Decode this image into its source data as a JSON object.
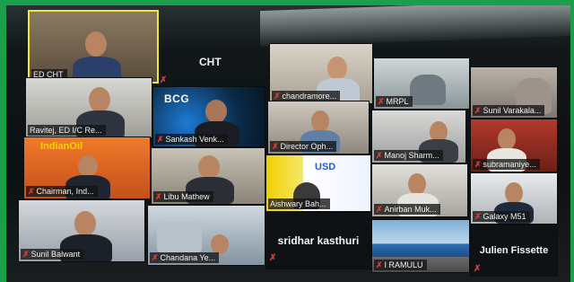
{
  "call": {
    "host_name": "CHT",
    "tiles": [
      {
        "id": "ed-cht",
        "label": "ED CHT",
        "muted": false,
        "active": true
      },
      {
        "id": "ravitej",
        "label": "Ravitej, ED I/C Re...",
        "muted": true
      },
      {
        "id": "bcg",
        "label": "Sankash Venk...",
        "muted": true,
        "logo": "BCG"
      },
      {
        "id": "chandramore",
        "label": "chandramore...",
        "muted": true
      },
      {
        "id": "mrpl",
        "label": "MRPL",
        "muted": true
      },
      {
        "id": "sunil-v",
        "label": "Sunil Varakala...",
        "muted": true
      },
      {
        "id": "indianoil",
        "label": "Chairman, Ind...",
        "muted": true,
        "logo": "IndianOil"
      },
      {
        "id": "libu",
        "label": "Libu Mathew",
        "muted": true
      },
      {
        "id": "director",
        "label": "Director Oph...",
        "muted": true
      },
      {
        "id": "manoj",
        "label": "Manoj Sharm...",
        "muted": true
      },
      {
        "id": "subramaniye",
        "label": "subramaniye...",
        "muted": true
      },
      {
        "id": "aishwary",
        "label": "Aishwary Bah...",
        "muted": false,
        "logo": "USD"
      },
      {
        "id": "anirban",
        "label": "Anirban Muk...",
        "muted": true
      },
      {
        "id": "galaxy",
        "label": "Galaxy M51",
        "muted": true
      },
      {
        "id": "sunil-b",
        "label": "Sunil Balwant",
        "muted": true
      },
      {
        "id": "chandana",
        "label": "Chandana Ye...",
        "muted": true
      },
      {
        "id": "sridhar",
        "label": "sridhar kasthuri",
        "muted": true,
        "no_video": true
      },
      {
        "id": "ramulu",
        "label": "I RAMULU",
        "muted": true
      },
      {
        "id": "julien",
        "label": "Julien Fissette",
        "muted": true,
        "no_video": true
      }
    ]
  },
  "mute_glyph": "✗",
  "colors": {
    "accent": "#1aa04a",
    "active_border": "#f0e443",
    "mute": "#e53935"
  }
}
